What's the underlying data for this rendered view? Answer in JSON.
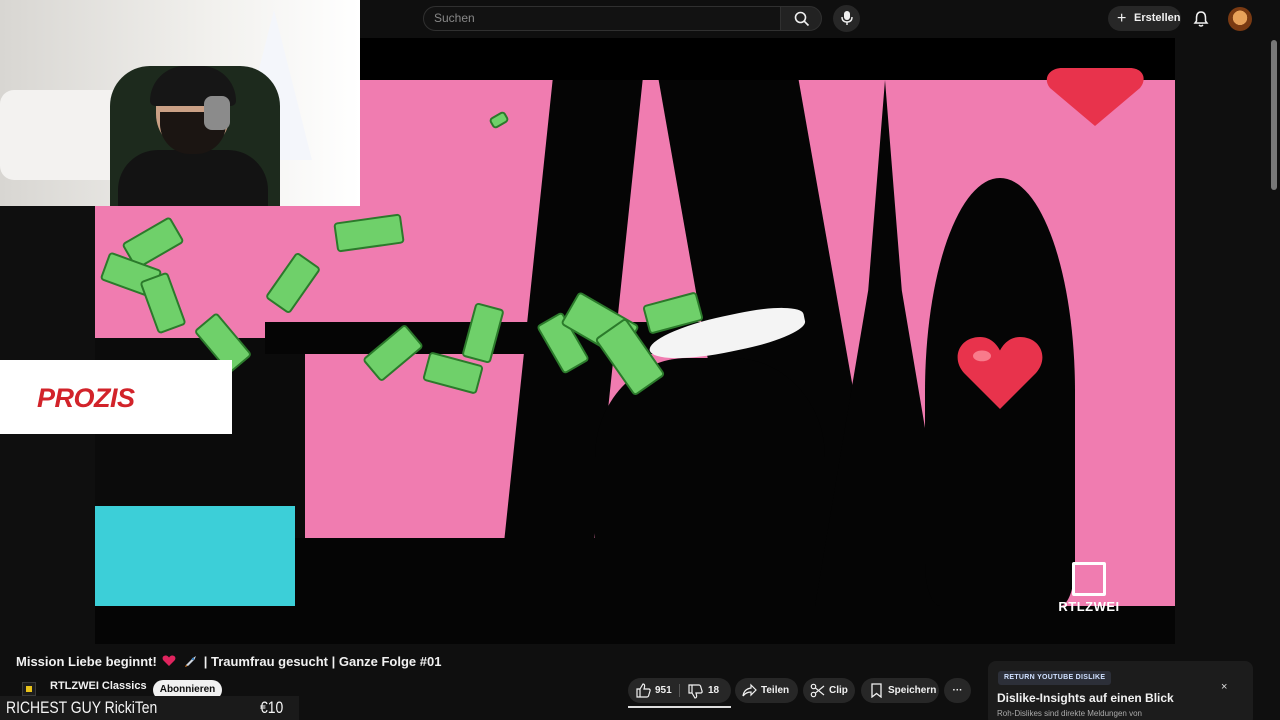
{
  "header": {
    "search_placeholder": "Suchen",
    "create_label": "Erstellen"
  },
  "overlay": {
    "ad_brand": "PROZIS",
    "ticker_text": "RICHEST GUY RickiTen",
    "ticker_amount": "€10"
  },
  "video": {
    "watermark": "RTLZWEI",
    "title_part1": "Mission Liebe beginnt!",
    "title_part2": "| Traumfrau gesucht | Ganze Folge #01"
  },
  "channel": {
    "name": "RTLZWEI Classics",
    "subscribe_label": "Abonnieren"
  },
  "actions": {
    "likes": "951",
    "dislikes": "18",
    "share_label": "Teilen",
    "clip_label": "Clip",
    "save_label": "Speichern",
    "more_label": "···"
  },
  "dislike_card": {
    "badge": "RETURN YOUTUBE DISLIKE",
    "title": "Dislike-Insights auf einen Blick",
    "subtitle": "Roh-Dislikes sind direkte Meldungen von",
    "close": "×"
  }
}
